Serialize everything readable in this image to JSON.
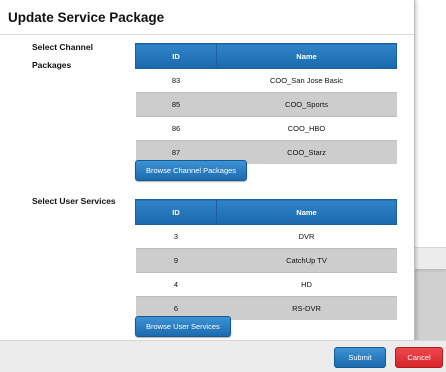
{
  "dialog": {
    "title": "Update Service Package"
  },
  "channel_packages": {
    "label_line1": "Select Channel",
    "label_line2": "Packages",
    "columns": [
      "ID",
      "Name"
    ],
    "rows": [
      {
        "id": "83",
        "name": "COO_San Jose Basic"
      },
      {
        "id": "85",
        "name": "COO_Sports"
      },
      {
        "id": "86",
        "name": "COO_HBO"
      },
      {
        "id": "87",
        "name": "COO_Starz"
      }
    ],
    "browse_label": "Browse Channel Packages"
  },
  "user_services": {
    "label": "Select User Services",
    "columns": [
      "ID",
      "Name"
    ],
    "rows": [
      {
        "id": "3",
        "name": "DVR"
      },
      {
        "id": "9",
        "name": "CatchUp TV"
      },
      {
        "id": "4",
        "name": "HD"
      },
      {
        "id": "6",
        "name": "RS-DVR"
      }
    ],
    "browse_label": "Browse User Services"
  },
  "footer": {
    "submit_label": "Submit",
    "cancel_label": "Cancel"
  },
  "colors": {
    "header_blue": "#1a68ad",
    "button_blue": "#1c6aaf",
    "cancel_red": "#d6242a",
    "row_alt_gray": "#cdcdcd"
  }
}
